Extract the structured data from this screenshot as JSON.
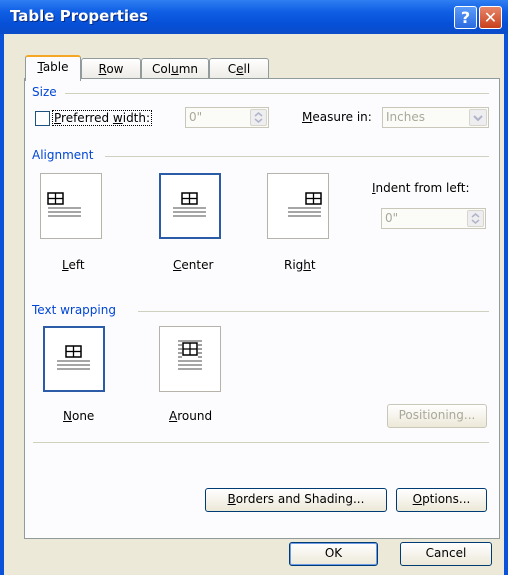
{
  "window": {
    "title": "Table Properties"
  },
  "titlebar": {
    "help": "?",
    "close": "✕"
  },
  "tabs": [
    {
      "pre": "",
      "u": "T",
      "post": "able"
    },
    {
      "pre": "",
      "u": "R",
      "post": "ow"
    },
    {
      "pre": "Col",
      "u": "u",
      "post": "mn"
    },
    {
      "pre": "C",
      "u": "e",
      "post": "ll"
    }
  ],
  "size": {
    "group": "Size",
    "pref_pre": "",
    "pref_u": "P",
    "pref_post": "referred ",
    "pref_u2": "w",
    "pref_post2": "idth:",
    "width_value": "0\"",
    "measure_pre": "",
    "measure_u": "M",
    "measure_post": "easure in:",
    "measure_value": "Inches"
  },
  "alignment": {
    "group": "Alignment",
    "left": {
      "pre": "",
      "u": "L",
      "post": "eft"
    },
    "center": {
      "pre": "",
      "u": "C",
      "post": "enter"
    },
    "right": {
      "pre": "Rig",
      "u": "h",
      "post": "t"
    },
    "indent_pre": "",
    "indent_u": "I",
    "indent_post": "ndent from left:",
    "indent_value": "0\""
  },
  "wrapping": {
    "group": "Text wrapping",
    "none": {
      "pre": "",
      "u": "N",
      "post": "one"
    },
    "around": {
      "pre": "",
      "u": "A",
      "post": "round"
    },
    "positioning": "Positioning..."
  },
  "buttons": {
    "borders_pre": "",
    "borders_u": "B",
    "borders_post": "orders and Shading...",
    "options_pre": "",
    "options_u": "O",
    "options_post": "ptions...",
    "ok": "OK",
    "cancel": "Cancel"
  }
}
